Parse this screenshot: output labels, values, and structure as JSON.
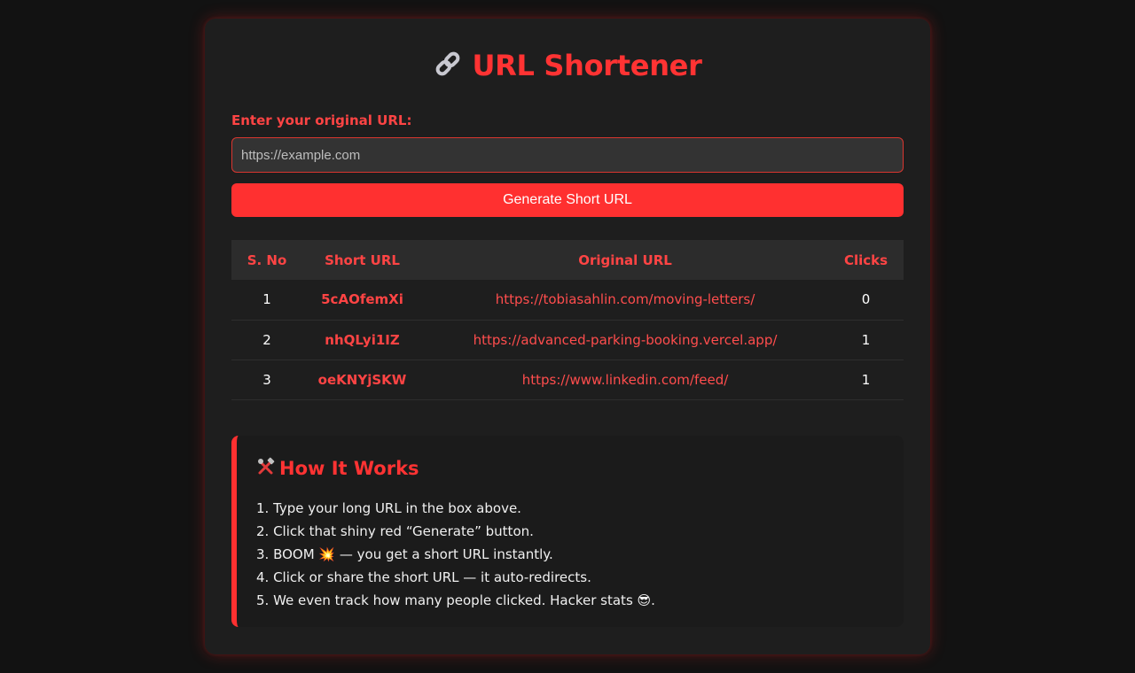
{
  "header": {
    "title": "URL Shortener",
    "icon": "link-icon"
  },
  "form": {
    "label": "Enter your original URL:",
    "placeholder": "https://example.com",
    "value": "",
    "button_label": "Generate Short URL"
  },
  "table": {
    "columns": [
      "S. No",
      "Short URL",
      "Original URL",
      "Clicks"
    ],
    "rows": [
      {
        "sno": "1",
        "short": "5cAOfemXi",
        "original": "https://tobiasahlin.com/moving-letters/",
        "clicks": "0"
      },
      {
        "sno": "2",
        "short": "nhQLyi1IZ",
        "original": "https://advanced-parking-booking.vercel.app/",
        "clicks": "1"
      },
      {
        "sno": "3",
        "short": "oeKNYjSKW",
        "original": "https://www.linkedin.com/feed/",
        "clicks": "1"
      }
    ]
  },
  "how_it_works": {
    "title": "How It Works",
    "icon": "tools-icon",
    "steps": [
      "1. Type your long URL in the box above.",
      "2. Click that shiny red “Generate” button.",
      "3. BOOM 💥 — you get a short URL instantly.",
      "4. Click or share the short URL — it auto-redirects.",
      "5. We even track how many people clicked. Hacker stats 😎."
    ]
  },
  "colors": {
    "background": "#121212",
    "card": "#1e1e1e",
    "accent": "#ff3030",
    "header_row": "#2c2c2c",
    "input_bg": "#333333"
  }
}
